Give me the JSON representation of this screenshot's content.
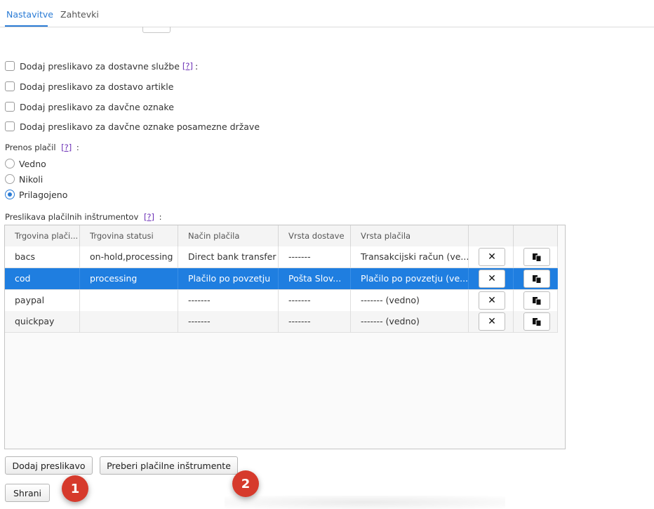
{
  "tabs": [
    {
      "label": "Nastavitve",
      "active": true
    },
    {
      "label": "Zahtevki",
      "active": false
    }
  ],
  "checkboxes": [
    {
      "label": "Dodaj preslikavo za dostavne službe",
      "help": "[?]",
      "colon": ":",
      "checked": false
    },
    {
      "label": "Dodaj preslikavo za dostavo artikle",
      "checked": false
    },
    {
      "label": "Dodaj preslikavo za davčne oznake",
      "checked": false
    },
    {
      "label": "Dodaj preslikavo za davčne oznake posamezne države",
      "checked": false
    }
  ],
  "payment_transfer": {
    "label": "Prenos plačil",
    "help": "[?]",
    "colon": ":",
    "options": [
      {
        "label": "Vedno",
        "checked": false
      },
      {
        "label": "Nikoli",
        "checked": false
      },
      {
        "label": "Prilagojeno",
        "checked": true
      }
    ]
  },
  "mapping": {
    "label": "Preslikava plačilnih inštrumentov",
    "help": "[?]",
    "colon": ":",
    "columns": [
      "Trgovina plači...",
      "Trgovina statusi",
      "Način plačila",
      "Vrsta dostave",
      "Vrsta plačila"
    ],
    "rows": [
      {
        "cells": [
          "bacs",
          "on-hold,processing",
          "Direct bank transfer",
          "-------",
          "Transakcijski račun (ve..."
        ],
        "selected": false
      },
      {
        "cells": [
          "cod",
          "processing",
          "Plačilo po povzetju",
          "Pošta Slov...",
          "Plačilo po povzetju (ve..."
        ],
        "selected": true
      },
      {
        "cells": [
          "paypal",
          "",
          "-------",
          "-------",
          "------- (vedno)"
        ],
        "selected": false
      },
      {
        "cells": [
          "quickpay",
          "",
          "-------",
          "-------",
          "------- (vedno)"
        ],
        "selected": false
      }
    ],
    "delete_icon": "close-icon",
    "copy_icon": "copy-icon"
  },
  "buttons": {
    "add_mapping": "Dodaj preslikavo",
    "read_instruments": "Preberi plačilne inštrumente",
    "save": "Shrani"
  },
  "badges": [
    "1",
    "2"
  ],
  "colors": {
    "accent": "#2a7bd5",
    "selected_row": "#1f7ee0",
    "badge": "#d63a2c",
    "help_link": "#6b2fb6"
  }
}
